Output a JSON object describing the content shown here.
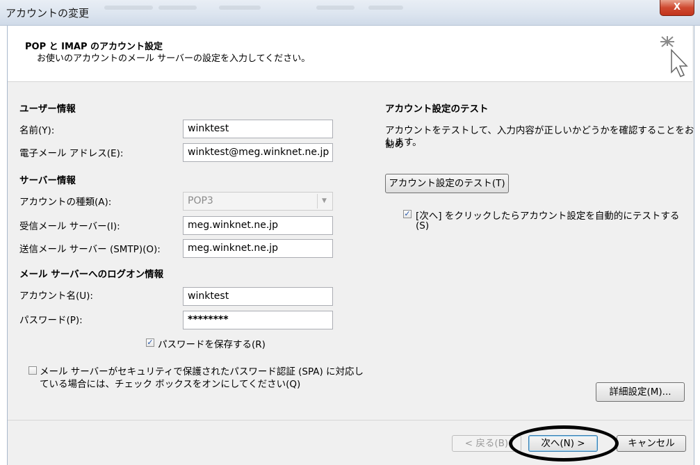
{
  "window": {
    "title": "アカウントの変更",
    "close": "X"
  },
  "header": {
    "title": "POP と IMAP のアカウント設定",
    "subtitle": "お使いのアカウントのメール サーバーの設定を入力してください。"
  },
  "user_info": {
    "heading": "ユーザー情報",
    "name_label": "名前(Y):",
    "name_value": "winktest",
    "email_label": "電子メール アドレス(E):",
    "email_value": "winktest@meg.winknet.ne.jp"
  },
  "server_info": {
    "heading": "サーバー情報",
    "account_type_label": "アカウントの種類(A):",
    "account_type_value": "POP3",
    "incoming_label": "受信メール サーバー(I):",
    "incoming_value": "meg.winknet.ne.jp",
    "outgoing_label": "送信メール サーバー (SMTP)(O):",
    "outgoing_value": "meg.winknet.ne.jp"
  },
  "logon_info": {
    "heading": "メール サーバーへのログオン情報",
    "account_name_label": "アカウント名(U):",
    "account_name_value": "winktest",
    "password_label": "パスワード(P):",
    "password_value": "********",
    "save_password_label": "パスワードを保存する(R)",
    "save_password_checked": true,
    "spa_label_line1": "メール サーバーがセキュリティで保護されたパスワード認証 (SPA) に対応し",
    "spa_label_line2": "ている場合には、チェック ボックスをオンにしてください(Q)",
    "spa_checked": false
  },
  "test": {
    "heading": "アカウント設定のテスト",
    "description_line1": "アカウントをテストして、入力内容が正しいかどうかを確認することをお勧め",
    "description_line2": "します。",
    "test_button": "アカウント設定のテスト(T)",
    "auto_test_line1": "[次へ] をクリックしたらアカウント設定を自動的にテストする",
    "auto_test_line2": "(S)",
    "auto_test_checked": true
  },
  "buttons": {
    "more_settings": "詳細設定(M)...",
    "back": "< 戻る(B)",
    "next": "次へ(N) >",
    "cancel": "キャンセル"
  },
  "icons": {
    "check": "✓",
    "dropdown": "▼"
  }
}
